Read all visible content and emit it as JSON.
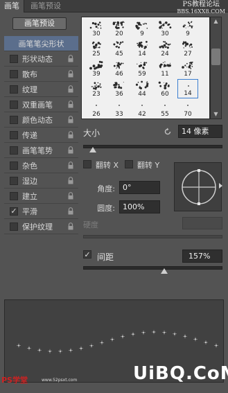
{
  "tabs": [
    {
      "label": "画笔",
      "active": true
    },
    {
      "label": "画笔预设",
      "active": false
    }
  ],
  "watermark": {
    "line1": "PS教程论坛",
    "line2": "BBS.16XX8.COM"
  },
  "preset_button": "画笔预设",
  "sidebar": {
    "items": [
      {
        "label": "画笔笔尖形状",
        "selected": true,
        "has_checkbox": false,
        "checked": false,
        "locked": false
      },
      {
        "label": "形状动态",
        "selected": false,
        "has_checkbox": true,
        "checked": false,
        "locked": true
      },
      {
        "label": "散布",
        "selected": false,
        "has_checkbox": true,
        "checked": false,
        "locked": true
      },
      {
        "label": "纹理",
        "selected": false,
        "has_checkbox": true,
        "checked": false,
        "locked": true
      },
      {
        "label": "双重画笔",
        "selected": false,
        "has_checkbox": true,
        "checked": false,
        "locked": true
      },
      {
        "label": "颜色动态",
        "selected": false,
        "has_checkbox": true,
        "checked": false,
        "locked": true
      },
      {
        "label": "传递",
        "selected": false,
        "has_checkbox": true,
        "checked": false,
        "locked": true
      },
      {
        "label": "画笔笔势",
        "selected": false,
        "has_checkbox": true,
        "checked": false,
        "locked": true
      },
      {
        "label": "杂色",
        "selected": false,
        "has_checkbox": true,
        "checked": false,
        "locked": true
      },
      {
        "label": "湿边",
        "selected": false,
        "has_checkbox": true,
        "checked": false,
        "locked": true
      },
      {
        "label": "建立",
        "selected": false,
        "has_checkbox": true,
        "checked": false,
        "locked": true
      },
      {
        "label": "平滑",
        "selected": false,
        "has_checkbox": true,
        "checked": true,
        "locked": true
      },
      {
        "label": "保护纹理",
        "selected": false,
        "has_checkbox": true,
        "checked": false,
        "locked": true
      }
    ]
  },
  "brush_grid": {
    "rows": [
      [
        "30",
        "20",
        "9",
        "30",
        "9"
      ],
      [
        "25",
        "45",
        "14",
        "24",
        "27"
      ],
      [
        "39",
        "46",
        "59",
        "11",
        "17"
      ],
      [
        "23",
        "36",
        "44",
        "60",
        "14"
      ],
      [
        "26",
        "33",
        "42",
        "55",
        "70"
      ]
    ],
    "selected": {
      "row": 3,
      "col": 4
    }
  },
  "size": {
    "label": "大小",
    "value": "14 像素",
    "slider_fraction": 0.07
  },
  "flip": {
    "x_label": "翻转 X",
    "y_label": "翻转 Y",
    "x_checked": false,
    "y_checked": false
  },
  "angle": {
    "label": "角度:",
    "value": "0°"
  },
  "roundness": {
    "label": "圆度:",
    "value": "100%"
  },
  "hardness": {
    "label": "硬度",
    "value": ""
  },
  "spacing": {
    "label": "间距",
    "checked": true,
    "value": "157%",
    "slider_fraction": 0.58
  },
  "footer": {
    "left_text": "PS学堂",
    "site_text": "www.52psxt.com",
    "logo": "UiBQ.CoM"
  },
  "colors": {
    "panel_bg": "#535353",
    "selection": "#5b6e8c",
    "grid_bg": "#f0f0f0",
    "field_bg": "#2f2f2f"
  }
}
